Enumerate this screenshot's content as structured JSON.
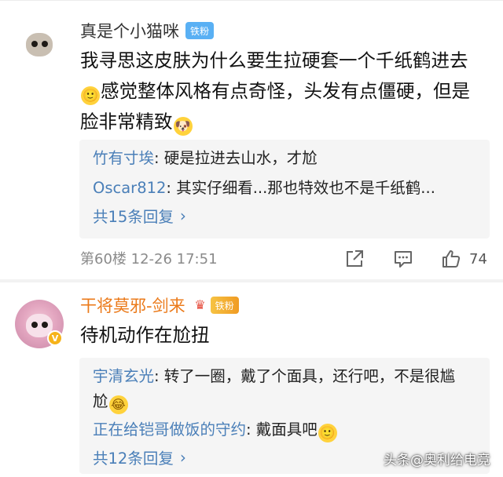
{
  "comments": [
    {
      "username": "真是个小猫咪",
      "badge": "铁粉",
      "text_lines": [
        "我寻思这皮肤为什么要生拉硬套一个千纸鹤进去",
        "感觉整体风格有点奇怪，头发有点僵硬，但是",
        "脸非常精致"
      ],
      "replies": [
        {
          "name": "竹有寸埃",
          "text": "硬是拉进去山水，才尬"
        },
        {
          "name": "Oscar812",
          "text": "其实仔细看...那也特效也不是千纸鹤..."
        }
      ],
      "more_label": "共15条回复",
      "meta": "第60楼  12-26 17:51",
      "likes": "74"
    },
    {
      "username": "干将莫邪-剑来",
      "badge": "铁粉",
      "verified": "V",
      "text": "待机动作在尬扭",
      "replies": [
        {
          "name": "宇清玄光",
          "text_line1": "转了一圈，戴了个面具，还行吧，不是很尴",
          "text_line2": "尬"
        },
        {
          "name": "正在给铠哥做饭的守约",
          "text": "戴面具吧"
        }
      ],
      "more_label": "共12条回复"
    }
  ],
  "icons": {
    "emoji_smile": "🙂",
    "emoji_doge": "🐶",
    "emoji_laugh": "😂",
    "chevron": "›",
    "crown": "♛"
  },
  "watermark": "头条@奥利给电竞",
  "colors": {
    "link": "#4a7fb8",
    "fan_badge": "#59b0f4",
    "gold_name": "#eb7a1a"
  }
}
